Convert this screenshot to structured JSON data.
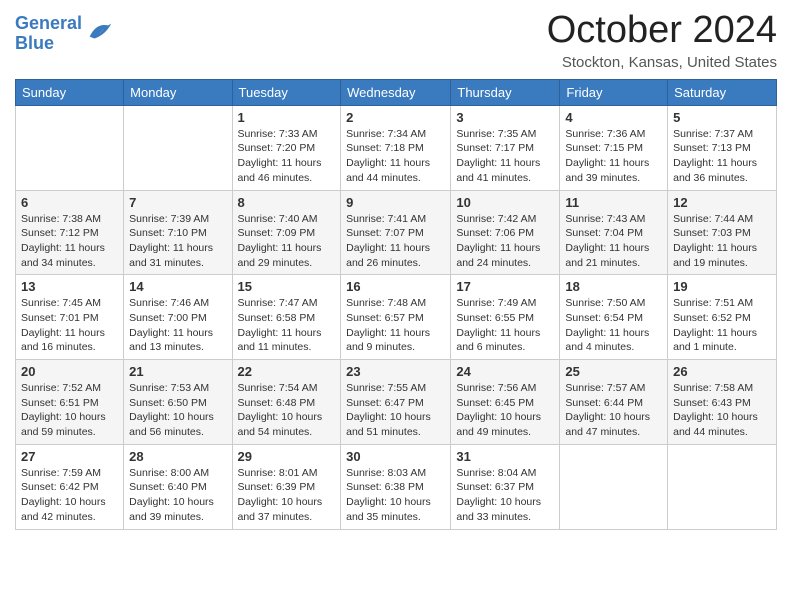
{
  "header": {
    "logo_line1": "General",
    "logo_line2": "Blue",
    "month": "October 2024",
    "location": "Stockton, Kansas, United States"
  },
  "days_of_week": [
    "Sunday",
    "Monday",
    "Tuesday",
    "Wednesday",
    "Thursday",
    "Friday",
    "Saturday"
  ],
  "weeks": [
    [
      {
        "day": null,
        "info": null
      },
      {
        "day": null,
        "info": null
      },
      {
        "day": "1",
        "info": "Sunrise: 7:33 AM\nSunset: 7:20 PM\nDaylight: 11 hours and 46 minutes."
      },
      {
        "day": "2",
        "info": "Sunrise: 7:34 AM\nSunset: 7:18 PM\nDaylight: 11 hours and 44 minutes."
      },
      {
        "day": "3",
        "info": "Sunrise: 7:35 AM\nSunset: 7:17 PM\nDaylight: 11 hours and 41 minutes."
      },
      {
        "day": "4",
        "info": "Sunrise: 7:36 AM\nSunset: 7:15 PM\nDaylight: 11 hours and 39 minutes."
      },
      {
        "day": "5",
        "info": "Sunrise: 7:37 AM\nSunset: 7:13 PM\nDaylight: 11 hours and 36 minutes."
      }
    ],
    [
      {
        "day": "6",
        "info": "Sunrise: 7:38 AM\nSunset: 7:12 PM\nDaylight: 11 hours and 34 minutes."
      },
      {
        "day": "7",
        "info": "Sunrise: 7:39 AM\nSunset: 7:10 PM\nDaylight: 11 hours and 31 minutes."
      },
      {
        "day": "8",
        "info": "Sunrise: 7:40 AM\nSunset: 7:09 PM\nDaylight: 11 hours and 29 minutes."
      },
      {
        "day": "9",
        "info": "Sunrise: 7:41 AM\nSunset: 7:07 PM\nDaylight: 11 hours and 26 minutes."
      },
      {
        "day": "10",
        "info": "Sunrise: 7:42 AM\nSunset: 7:06 PM\nDaylight: 11 hours and 24 minutes."
      },
      {
        "day": "11",
        "info": "Sunrise: 7:43 AM\nSunset: 7:04 PM\nDaylight: 11 hours and 21 minutes."
      },
      {
        "day": "12",
        "info": "Sunrise: 7:44 AM\nSunset: 7:03 PM\nDaylight: 11 hours and 19 minutes."
      }
    ],
    [
      {
        "day": "13",
        "info": "Sunrise: 7:45 AM\nSunset: 7:01 PM\nDaylight: 11 hours and 16 minutes."
      },
      {
        "day": "14",
        "info": "Sunrise: 7:46 AM\nSunset: 7:00 PM\nDaylight: 11 hours and 13 minutes."
      },
      {
        "day": "15",
        "info": "Sunrise: 7:47 AM\nSunset: 6:58 PM\nDaylight: 11 hours and 11 minutes."
      },
      {
        "day": "16",
        "info": "Sunrise: 7:48 AM\nSunset: 6:57 PM\nDaylight: 11 hours and 9 minutes."
      },
      {
        "day": "17",
        "info": "Sunrise: 7:49 AM\nSunset: 6:55 PM\nDaylight: 11 hours and 6 minutes."
      },
      {
        "day": "18",
        "info": "Sunrise: 7:50 AM\nSunset: 6:54 PM\nDaylight: 11 hours and 4 minutes."
      },
      {
        "day": "19",
        "info": "Sunrise: 7:51 AM\nSunset: 6:52 PM\nDaylight: 11 hours and 1 minute."
      }
    ],
    [
      {
        "day": "20",
        "info": "Sunrise: 7:52 AM\nSunset: 6:51 PM\nDaylight: 10 hours and 59 minutes."
      },
      {
        "day": "21",
        "info": "Sunrise: 7:53 AM\nSunset: 6:50 PM\nDaylight: 10 hours and 56 minutes."
      },
      {
        "day": "22",
        "info": "Sunrise: 7:54 AM\nSunset: 6:48 PM\nDaylight: 10 hours and 54 minutes."
      },
      {
        "day": "23",
        "info": "Sunrise: 7:55 AM\nSunset: 6:47 PM\nDaylight: 10 hours and 51 minutes."
      },
      {
        "day": "24",
        "info": "Sunrise: 7:56 AM\nSunset: 6:45 PM\nDaylight: 10 hours and 49 minutes."
      },
      {
        "day": "25",
        "info": "Sunrise: 7:57 AM\nSunset: 6:44 PM\nDaylight: 10 hours and 47 minutes."
      },
      {
        "day": "26",
        "info": "Sunrise: 7:58 AM\nSunset: 6:43 PM\nDaylight: 10 hours and 44 minutes."
      }
    ],
    [
      {
        "day": "27",
        "info": "Sunrise: 7:59 AM\nSunset: 6:42 PM\nDaylight: 10 hours and 42 minutes."
      },
      {
        "day": "28",
        "info": "Sunrise: 8:00 AM\nSunset: 6:40 PM\nDaylight: 10 hours and 39 minutes."
      },
      {
        "day": "29",
        "info": "Sunrise: 8:01 AM\nSunset: 6:39 PM\nDaylight: 10 hours and 37 minutes."
      },
      {
        "day": "30",
        "info": "Sunrise: 8:03 AM\nSunset: 6:38 PM\nDaylight: 10 hours and 35 minutes."
      },
      {
        "day": "31",
        "info": "Sunrise: 8:04 AM\nSunset: 6:37 PM\nDaylight: 10 hours and 33 minutes."
      },
      {
        "day": null,
        "info": null
      },
      {
        "day": null,
        "info": null
      }
    ]
  ]
}
